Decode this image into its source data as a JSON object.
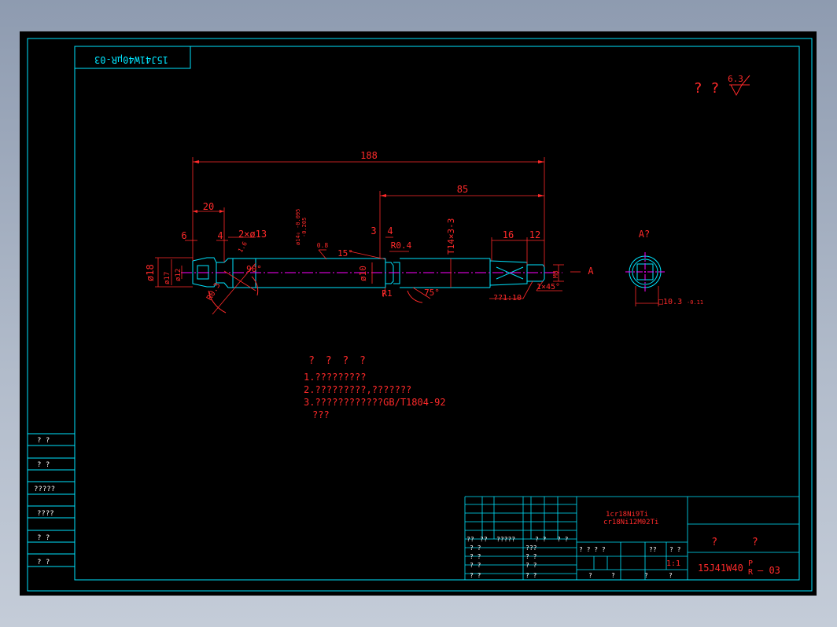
{
  "top_stamp": "15J41W40µR-03",
  "roughness": {
    "qmarks": "? ?",
    "value": "6.3"
  },
  "dims": {
    "overall": "188",
    "right_len": "85",
    "head_len": "20",
    "d6": "6",
    "d4": "4",
    "holes": "2×ø13",
    "tol_top": "ø14₀ -0.095",
    "tol_bottom": "-0.205",
    "rough_a": "0.8",
    "rough_b": "1.6",
    "d3": "3",
    "d4b": "4",
    "r04": "R0.4",
    "thread": "T14×3-3",
    "d16": "16",
    "d12": "12",
    "phi18": "ø18",
    "phi17": "ø17",
    "phi12": "ø12",
    "phi10": "ø10",
    "angle90": "90°",
    "angle15": "15°",
    "angle75": "75°",
    "r1": "R1",
    "taper": "??1:10",
    "chamfer": "1×45°",
    "m": "M8",
    "r03": "R0.3",
    "section_a": "A",
    "view_label": "A?",
    "square": "□10.3",
    "square_tol": "-0.11"
  },
  "notes": {
    "title": "? ? ? ?",
    "lines": [
      "1.?????????",
      "2.?????????,???????",
      "3.????????????GB/T1804-92",
      "???"
    ]
  },
  "left_strip": [
    "? ?",
    "? ?",
    "?????",
    "????",
    "? ?",
    "? ?"
  ],
  "title_block": {
    "materials": [
      "1cr18Ni9Ti",
      "cr18Ni12M02Ti"
    ],
    "name": "? ?",
    "drawing_no": "15J41W40",
    "drawing_no_sup": "P",
    "drawing_no_sub": "R",
    "drawing_no_suffix": "— 03",
    "scale": "1:1",
    "row_a": [
      "??",
      "??",
      "?????",
      "? ?",
      "? ?"
    ],
    "row_b": "? ? ? ?",
    "row_b2": "??",
    "row_b3": "? ?",
    "left_col": [
      "? ?",
      "? ?",
      "? ?",
      "? ?"
    ],
    "mid_col": [
      "???",
      "? ?",
      "? ?",
      "? ?"
    ],
    "bottom_row": [
      "?",
      "?",
      "?",
      "?"
    ]
  },
  "colors": {
    "line": "#00e5ff",
    "dim": "#ff2a2a",
    "center": "#ff00ff",
    "white": "#ffffff"
  }
}
